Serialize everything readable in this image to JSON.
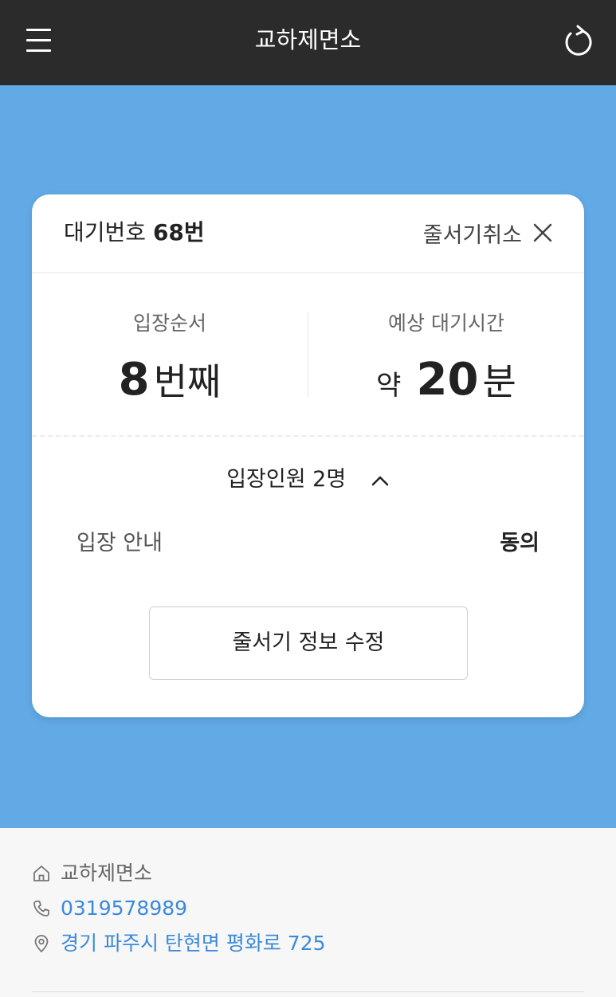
{
  "header": {
    "title": "교하제면소",
    "menu_icon": "hamburger-menu-icon",
    "refresh_icon": "refresh-icon"
  },
  "ticket": {
    "wait_label": "대기번호",
    "wait_number": "68번",
    "cancel_label": "줄서기취소",
    "order_label": "입장순서",
    "order_number": "8",
    "order_unit": "번째",
    "time_label": "예상 대기시간",
    "time_prefix": "약",
    "time_number": "20",
    "time_unit": "분",
    "party_label": "입장인원 2명",
    "guide_label": "입장 안내",
    "guide_value": "동의",
    "edit_label": "줄서기 정보 수정"
  },
  "store": {
    "name": "교하제면소",
    "phone": "0319578989",
    "address": "경기 파주시 탄현면 평화로 725"
  },
  "colors": {
    "topbar": "#2b2b2b",
    "hero": "#62aae6",
    "link": "#3b8ad9"
  }
}
